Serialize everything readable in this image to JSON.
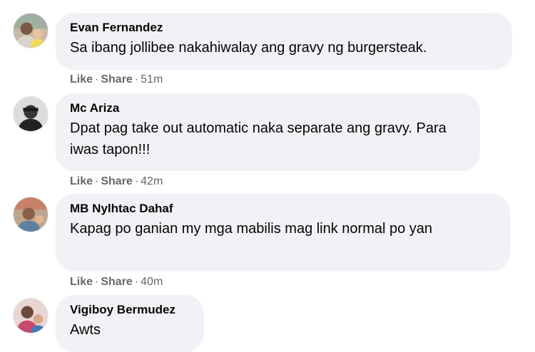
{
  "comments": [
    {
      "author": "Evan Fernandez",
      "text": "Sa ibang jollibee nakahiwalay ang gravy ng burgersteak.",
      "like": "Like",
      "share": "Share",
      "dot": "·",
      "time": "51m",
      "avatar": "profile-photo"
    },
    {
      "author": "Mc Ariza",
      "text": "Dpat pag take out automatic naka separate ang gravy. Para iwas tapon!!!",
      "like": "Like",
      "share": "Share",
      "dot": "·",
      "time": "42m",
      "avatar": "profile-photo"
    },
    {
      "author": "MB Nylhtac Dahaf",
      "text": "Kapag po ganian my mga mabilis mag link normal po yan",
      "like": "Like",
      "share": "Share",
      "dot": "·",
      "time": "40m",
      "avatar": "profile-photo"
    },
    {
      "author": "Vigiboy Bermudez",
      "text": "Awts",
      "avatar": "profile-photo"
    }
  ],
  "colors": {
    "bubble": "#f0f2f5",
    "meta": "#65676b",
    "text": "#050505"
  }
}
